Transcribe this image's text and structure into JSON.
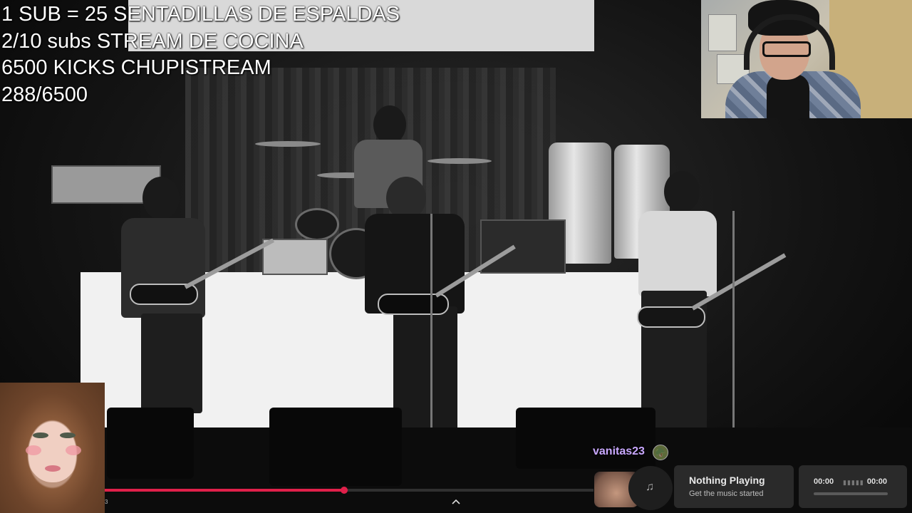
{
  "overlay": {
    "goals": [
      "1 SUB = 25 SENTADILLAS DE ESPALDAS",
      "2/10 subs STREAM DE COCINA",
      "6500 KICKS CHUPISTREAM",
      "288/6500"
    ]
  },
  "player": {
    "progress_percent": 49,
    "time_small": "3"
  },
  "chat": {
    "username": "vanitas23",
    "badge_icon": "🪖"
  },
  "music_widget": {
    "now_playing_title": "Nothing Playing",
    "now_playing_subtitle": "Get the music started",
    "time_elapsed": "00:00",
    "time_total": "00:00",
    "eq_glyph": "▮▮▮▮▮",
    "progress_percent": 0,
    "disc_icon": "♫"
  },
  "colors": {
    "progress": "#e0204a",
    "username": "#c9a8ff",
    "card_bg": "#2a2a2a"
  }
}
